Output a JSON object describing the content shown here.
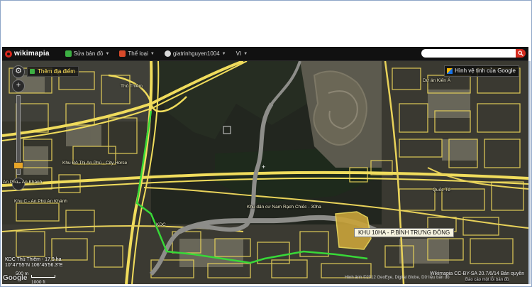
{
  "topbar": {
    "logo": "wikimapia",
    "menu": [
      {
        "label": "Sửa bản đồ",
        "icon": "edit-map-icon"
      },
      {
        "label": "Thể loại",
        "icon": "category-icon"
      },
      {
        "label": "giatrinhguyen1004",
        "icon": "user-icon"
      },
      {
        "label": "VI",
        "icon": ""
      }
    ],
    "search": {
      "placeholder": "",
      "value": ""
    }
  },
  "controls": {
    "add_place": "Thêm địa điểm",
    "satellite": "Hình vệ tinh của Google"
  },
  "map": {
    "labels": [
      "Thủ Thiêm",
      "Khu Đô Thị An Phú - City Horse",
      "An Phú - An Khánh",
      "Khu C - An Phú An Khánh",
      "KDC",
      "Khu dân cư Nam Rạch Chiếc - 30ha",
      "Dự án Kiến Á",
      "Quốc Tế"
    ],
    "project_label": "KHU 10HA - P.BÌNH TRƯNG ĐÔNG",
    "coords_line1": "KDC Thủ Thiêm - 17,9 ha",
    "coords_line2": "10°47'55\"N 106°45'56.3\"E",
    "scale_label": "500 m",
    "scale_label2": "1000 ft",
    "google": "Google",
    "provider": "Wikimapia CC-BY-SA 20.7/6/14 Bản quyền",
    "attribution": "Hình ảnh ©2012 GeoEye, Digital Globe, Dữ liệu bản đồ",
    "report": "Báo cáo một lỗi bản đồ",
    "colors": {
      "road": "#e8d25a",
      "route": "#38d838",
      "water": "#8a8a88",
      "accent": "#d52b1e"
    }
  }
}
